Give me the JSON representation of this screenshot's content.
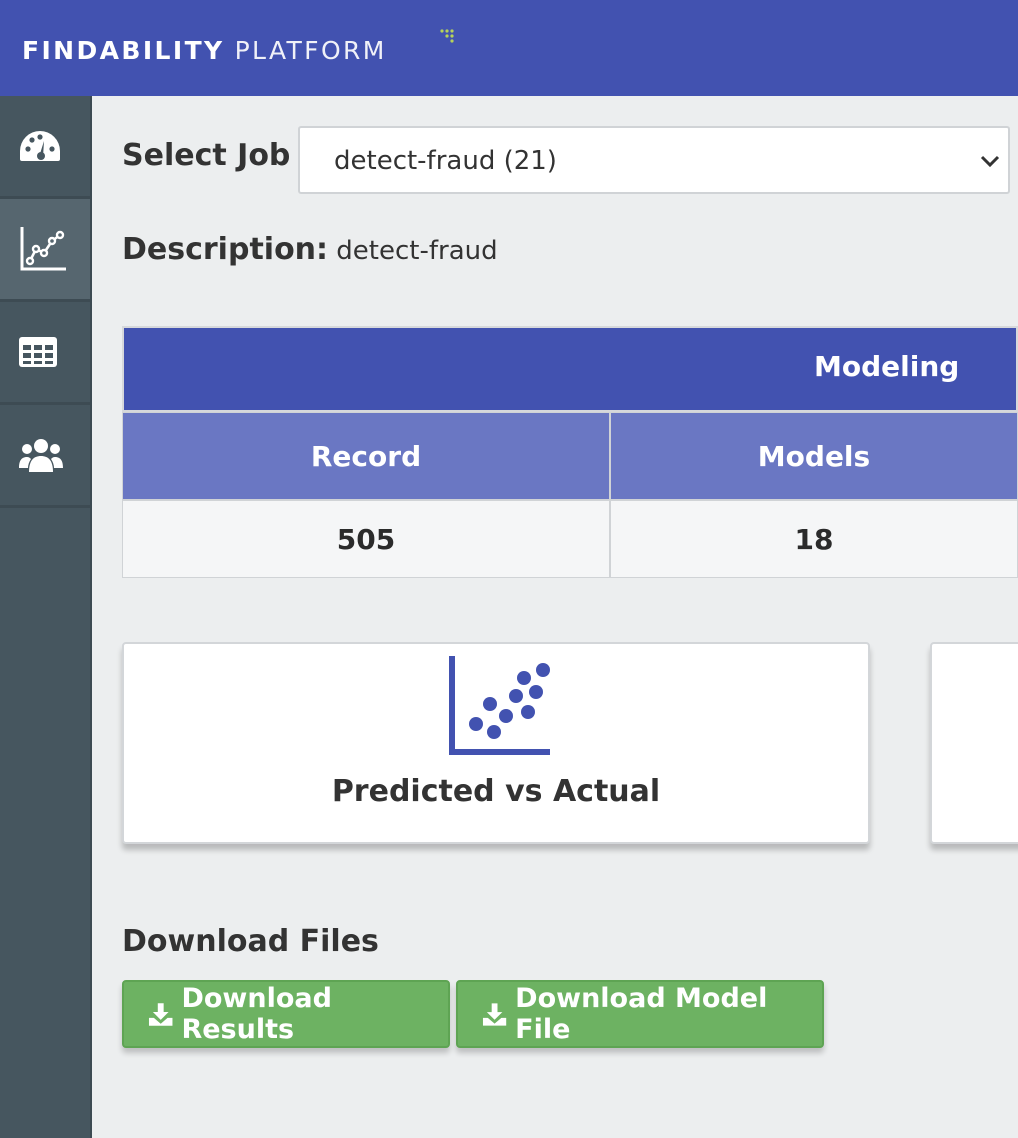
{
  "header": {
    "brand_bold": "FINDABILITY",
    "brand_light": "PLATFORM",
    "bg": "#4252b0"
  },
  "sidebar": {
    "items": [
      {
        "icon": "dashboard-gauge-icon",
        "active": false
      },
      {
        "icon": "scatter-chart-icon",
        "active": true
      },
      {
        "icon": "table-grid-icon",
        "active": false
      },
      {
        "icon": "users-group-icon",
        "active": false
      }
    ]
  },
  "job": {
    "label": "Select Job",
    "selected": "detect-fraud (21)"
  },
  "description": {
    "label": "Description:",
    "value": "detect-fraud"
  },
  "table": {
    "group_header": "Modeling",
    "columns": [
      "Record",
      "Models"
    ],
    "rows": [
      [
        "505",
        "18"
      ]
    ]
  },
  "cards": [
    {
      "label": "Predicted vs Actual",
      "icon": "scatter-plot-icon"
    }
  ],
  "downloads": {
    "title": "Download Files",
    "results_label": "Download Results",
    "model_label": "Download Model File",
    "color": "#6db262"
  }
}
